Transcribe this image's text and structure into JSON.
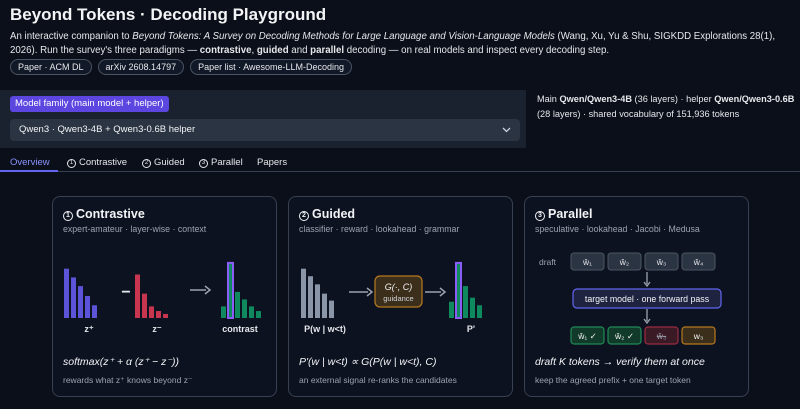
{
  "header": {
    "title": "Beyond Tokens · Decoding Playground",
    "desc_prefix": "An interactive companion to ",
    "desc_book": "Beyond Tokens: A Survey on Decoding Methods for Large Language and Vision-Language Models",
    "desc_cite": " (Wang, Xu, Yu & Shu, SIGKDD Explorations 28(1), 2026). Run the survey's three paradigms — ",
    "desc_p1": "contrastive",
    "desc_sep1": ", ",
    "desc_p2": "guided",
    "desc_sep2": " and ",
    "desc_p3": "parallel",
    "desc_suffix": " decoding — on real models and inspect every decoding step.",
    "pills": [
      "Paper · ACM DL",
      "arXiv 2608.14797",
      "Paper list · Awesome-LLM-Decoding"
    ]
  },
  "model": {
    "label": "Model family (main model + helper)",
    "selected": "Qwen3 · Qwen3-4B + Qwen3-0.6B helper",
    "info_main_prefix": "Main ",
    "info_main_model": "Qwen/Qwen3-4B",
    "info_main_layers": " (36 layers) · helper ",
    "info_helper_model": "Qwen/Qwen3-0.6B",
    "info_helper_rest": " (28 layers) · shared vocabulary of 151,936 tokens"
  },
  "tabs": [
    {
      "label": "Overview",
      "icon": ""
    },
    {
      "label": "Contrastive",
      "icon": "circled-1-icon"
    },
    {
      "label": "Guided",
      "icon": "circled-2-icon"
    },
    {
      "label": "Parallel",
      "icon": "circled-3-icon"
    },
    {
      "label": "Papers",
      "icon": ""
    }
  ],
  "cards": {
    "contrastive": {
      "num": "1",
      "title": "Contrastive",
      "subtitle": "expert-amateur · layer-wise · context",
      "lbl_plus": "z⁺",
      "lbl_minus": "z⁻",
      "lbl_contrast": "contrast",
      "minus_sign": "−",
      "formula": "softmax(z⁺ + α (z⁺ − z⁻))",
      "foot": "rewards what z⁺ knows beyond z⁻",
      "expert_values": [
        0.85,
        0.7,
        0.55,
        0.38,
        0.22
      ],
      "amateur_values": [
        0.75,
        0.42,
        0.2,
        0.12,
        0.07
      ],
      "contrast_values": [
        0.2,
        0.95,
        0.45,
        0.32,
        0.2,
        0.12
      ],
      "colors": {
        "expert": "#5b53d8",
        "amateur": "#c8354f",
        "contrast": "#0f8a5f",
        "highlight": "#8b5cf6"
      }
    },
    "guided": {
      "num": "2",
      "title": "Guided",
      "subtitle": "classifier · reward · lookahead · grammar",
      "box_title": "G(·, C)",
      "box_sub": "guidance",
      "lbl_prior": "P(w | w<t)",
      "lbl_post": "P'",
      "formula": "P'(w | w<t) ∝ G(P(w | w<t), C)",
      "foot": "an external signal re-ranks the candidates",
      "prior_values": [
        0.85,
        0.72,
        0.58,
        0.42,
        0.3
      ],
      "post_values": [
        0.28,
        0.95,
        0.55,
        0.35,
        0.22
      ],
      "colors": {
        "prior": "#8b95a8",
        "post": "#0f8a5f",
        "highlight": "#8b5cf6",
        "box_border": "#b7791f",
        "box_fill": "#3b2e1a"
      }
    },
    "parallel": {
      "num": "3",
      "title": "Parallel",
      "subtitle": "speculative · lookahead · Jacobi · Medusa",
      "draft_label": "draft",
      "draft_tokens": [
        "ŵ₁",
        "ŵ₂",
        "ŵ₃",
        "ŵ₄"
      ],
      "target_label": "target model · one forward pass",
      "verify_tokens": [
        "ŵ₁ ✓",
        "ŵ₂ ✓",
        "ŵ₃",
        "w₃"
      ],
      "verify_states": [
        "accept",
        "accept",
        "reject",
        "new"
      ],
      "formula": "draft K tokens → verify them at once",
      "foot": "keep the agreed prefix + one target token",
      "colors": {
        "accept_fill": "#123a2a",
        "accept_border": "#1f8a57",
        "reject_fill": "#3a1a24",
        "reject_border": "#9b2c42",
        "new_fill": "#3b2e1a",
        "new_border": "#b7791f",
        "target_border": "#6366f1",
        "target_fill": "#1e2340"
      }
    }
  }
}
